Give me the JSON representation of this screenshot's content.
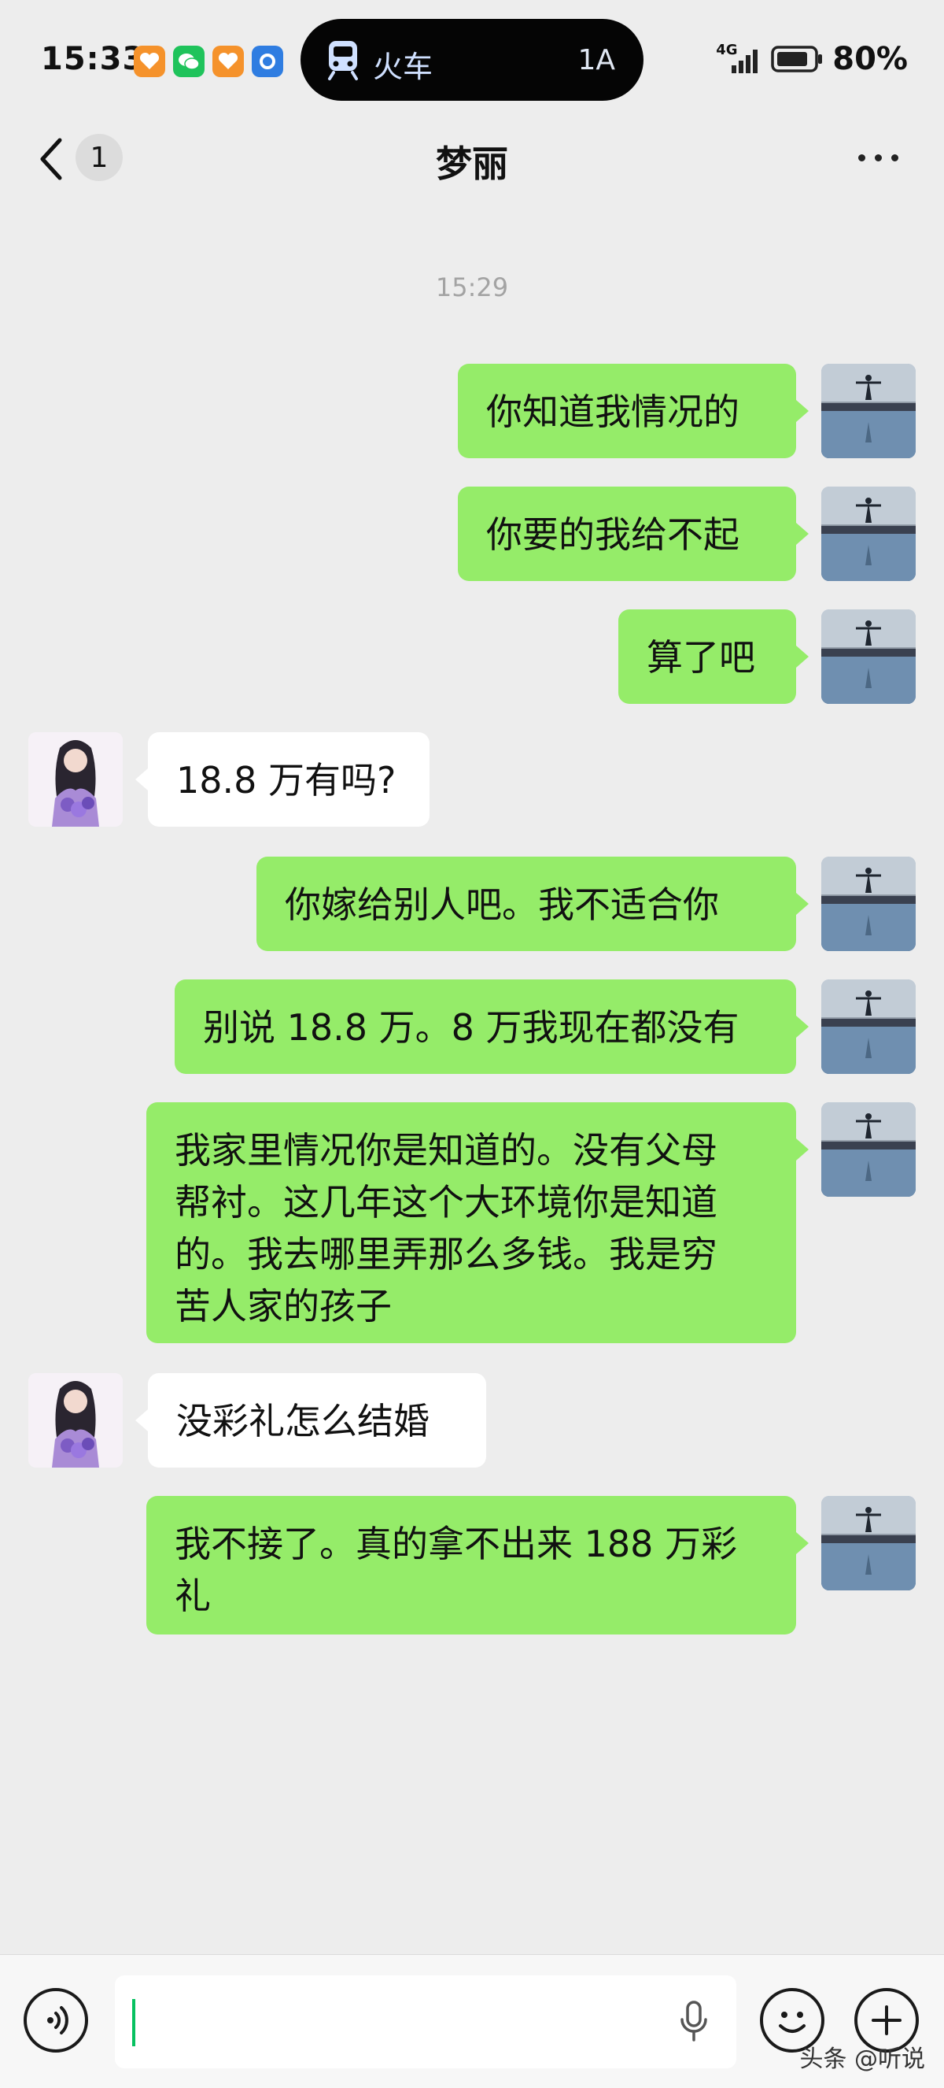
{
  "status_bar": {
    "time": "15:33",
    "network": "4G",
    "battery": "80%",
    "island": {
      "label": "火车",
      "seat": "1A"
    },
    "notification_icons": [
      "heart-app-icon",
      "wechat-icon",
      "heart-app-icon",
      "blue-app-icon"
    ]
  },
  "header": {
    "unread_count": "1",
    "title": "梦丽"
  },
  "timestamp": "15:29",
  "messages": [
    {
      "sender": "me",
      "text": "你知道我情况的"
    },
    {
      "sender": "me",
      "text": "你要的我给不起"
    },
    {
      "sender": "me",
      "text": "算了吧"
    },
    {
      "sender": "her",
      "text": "18.8 万有吗?"
    },
    {
      "sender": "me",
      "text": "你嫁给别人吧。我不适合你"
    },
    {
      "sender": "me",
      "text": "别说 18.8 万。8 万我现在都没有"
    },
    {
      "sender": "me",
      "text": "我家里情况你是知道的。没有父母\n帮衬。这几年这个大环境你是知道\n的。我去哪里弄那么多钱。我是穷\n苦人家的孩子"
    },
    {
      "sender": "her",
      "text": "没彩礼怎么结婚"
    },
    {
      "sender": "me",
      "text": "我不接了。真的拿不出来 188 万彩\n礼"
    }
  ],
  "input": {
    "value": ""
  },
  "watermark": "头条 @听说",
  "colors": {
    "my_bubble": "#95ec69",
    "their_bubble": "#ffffff",
    "background": "#ededed",
    "caret": "#07c160"
  }
}
